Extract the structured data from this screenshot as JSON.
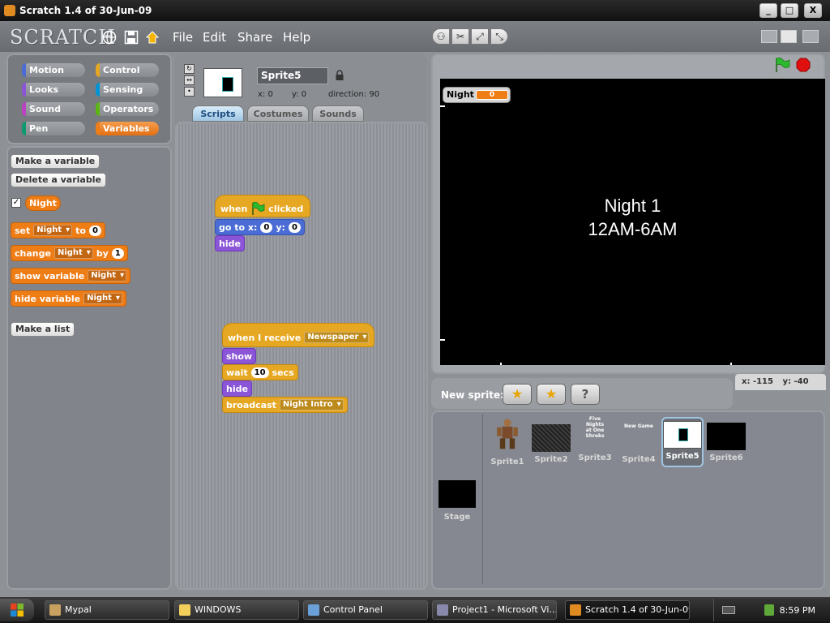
{
  "window": {
    "title": "Scratch 1.4 of 30-Jun-09",
    "minimize": "_",
    "maximize": "□",
    "close": "X"
  },
  "menubar": {
    "logo": "SCRATCH",
    "menus": [
      "File",
      "Edit",
      "Share",
      "Help"
    ]
  },
  "categories": [
    {
      "label": "Motion",
      "color": "#4a6cd4"
    },
    {
      "label": "Control",
      "color": "#e6a822"
    },
    {
      "label": "Looks",
      "color": "#8a55d7"
    },
    {
      "label": "Sensing",
      "color": "#0093d5"
    },
    {
      "label": "Sound",
      "color": "#bb42c3"
    },
    {
      "label": "Operators",
      "color": "#5cb712"
    },
    {
      "label": "Pen",
      "color": "#0e9a6c"
    },
    {
      "label": "Variables",
      "color": "#ee7d16",
      "selected": true
    }
  ],
  "palette": {
    "make_variable": "Make a variable",
    "delete_variable": "Delete a variable",
    "variable_name": "Night",
    "set_label": "set",
    "set_to": "to",
    "set_value": "0",
    "change_label": "change",
    "change_by": "by",
    "change_value": "1",
    "show_variable": "show variable",
    "hide_variable": "hide variable",
    "make_list": "Make a list"
  },
  "sprite_info": {
    "name": "Sprite5",
    "x": "x: 0",
    "y": "y: 0",
    "direction": "direction: 90"
  },
  "tabs": [
    "Scripts",
    "Costumes",
    "Sounds"
  ],
  "scripts": {
    "hat1": "when",
    "hat1b": "clicked",
    "goto": "go to x:",
    "goto_x": "0",
    "goto_y_label": "y:",
    "goto_y": "0",
    "hide1": "hide",
    "hat2": "when I receive",
    "hat2_msg": "Newspaper",
    "show": "show",
    "wait": "wait",
    "wait_value": "10",
    "secs": "secs",
    "hide2": "hide",
    "broadcast": "broadcast",
    "broadcast_msg": "Night Intro"
  },
  "stage": {
    "monitor_label": "Night",
    "monitor_value": "0",
    "line1": "Night 1",
    "line2": "12AM-6AM",
    "mouse_x_label": "x:",
    "mouse_x": "-115",
    "mouse_y_label": "y:",
    "mouse_y": "-40"
  },
  "sprite_list": {
    "new_sprite": "New sprite:",
    "sprites": [
      "Sprite1",
      "Sprite2",
      "Sprite3",
      "Sprite4",
      "Sprite5",
      "Sprite6"
    ],
    "selected": "Sprite5",
    "stage_label": "Stage",
    "sprite3_thumb_text": "Five Nights at One Shreks",
    "sprite4_thumb_text": "New Game"
  },
  "taskbar": {
    "items": [
      "Mypal",
      "WINDOWS",
      "Control Panel",
      "Project1 - Microsoft Vi...",
      "Scratch 1.4 of 30-Jun-09"
    ],
    "clock": "8:59 PM"
  }
}
